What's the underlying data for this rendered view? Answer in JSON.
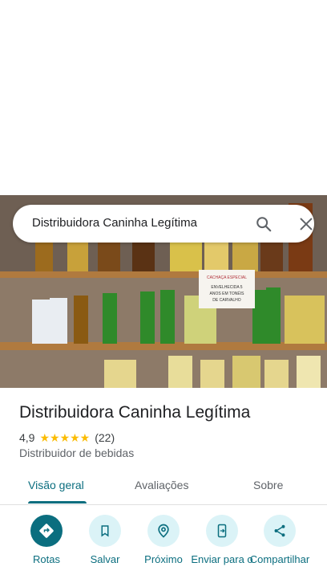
{
  "search": {
    "query": "Distribuidora Caninha Legítima"
  },
  "place": {
    "name": "Distribuidora Caninha Legítima",
    "rating": "4,9",
    "stars": "★★★★★",
    "review_count": "(22)",
    "category": "Distribuidor de bebidas"
  },
  "photo": {
    "sign_line1": "CACHAÇA ESPECIAL",
    "sign_line2": "ENVELHECIDA 5",
    "sign_line3": "ANOS EM TONÉIS",
    "sign_line4": "DE CARVALHO"
  },
  "tabs": [
    {
      "label": "Visão geral",
      "active": true
    },
    {
      "label": "Avaliações",
      "active": false
    },
    {
      "label": "Sobre",
      "active": false
    }
  ],
  "actions": [
    {
      "label": "Rotas",
      "icon": "directions-icon"
    },
    {
      "label": "Salvar",
      "icon": "bookmark-icon"
    },
    {
      "label": "Próximo",
      "icon": "nearby-icon"
    },
    {
      "label": "Enviar para o",
      "icon": "send-to-phone-icon"
    },
    {
      "label": "Compartilhar",
      "icon": "share-icon"
    }
  ],
  "colors": {
    "accent": "#0b6e7f",
    "accent_light": "#dbf3f7",
    "star": "#fbbc04"
  }
}
